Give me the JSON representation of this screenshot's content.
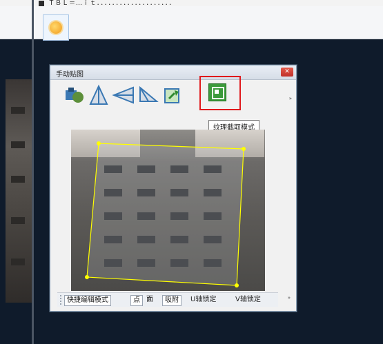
{
  "app": {
    "header_text": "ＴＢＬ＝…ｉｔ．．．．．．．．．．．．．．．．．．．．",
    "sun_button_icon": "sun-icon"
  },
  "panel": {
    "title": "手动贴图",
    "close_icon": "close-icon",
    "toolbar_icons": [
      "camera-transform-icon",
      "triangle-vertical-icon",
      "wedge-left-icon",
      "wedge-down-icon",
      "rotate-icon",
      "texture-capture-icon"
    ],
    "overflow_glyph": "»",
    "tooltip": "纹理截取模式",
    "bottom_bar": {
      "buttons": [
        "快捷编辑模式",
        "点",
        "面",
        "吸附",
        "U轴锁定",
        "V轴锁定"
      ],
      "overflow_glyph": "»"
    }
  },
  "colors": {
    "desktop_bg": "#0f1b2b",
    "selection": "#ffff00",
    "active_border": "#e0191c"
  }
}
